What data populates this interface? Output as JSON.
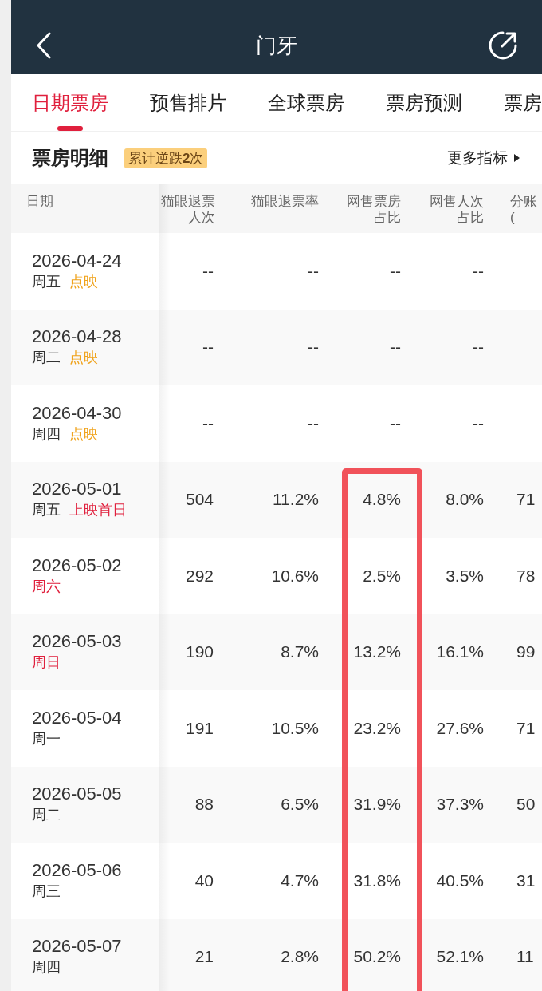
{
  "header": {
    "title": "门牙"
  },
  "tabs": [
    {
      "label": "日期票房",
      "selected": true
    },
    {
      "label": "预售排片",
      "selected": false
    },
    {
      "label": "全球票房",
      "selected": false
    },
    {
      "label": "票房预测",
      "selected": false
    },
    {
      "label": "票房",
      "selected": false
    }
  ],
  "section": {
    "title": "票房明细",
    "badge": "累计逆跌**2**次",
    "more_link": "更多指标"
  },
  "table": {
    "columns": [
      "日期",
      "猫眼退票人次",
      "猫眼退票率",
      "网售票房占比",
      "网售人次占比",
      "分账("
    ],
    "rows": [
      {
        "date": "2026-04-24",
        "weekday": "周五",
        "weekend": false,
        "tag": {
          "text": "点映",
          "kind": "preview"
        },
        "values": [
          "--",
          "--",
          "--",
          "--"
        ]
      },
      {
        "date": "2026-04-28",
        "weekday": "周二",
        "weekend": false,
        "tag": {
          "text": "点映",
          "kind": "preview"
        },
        "values": [
          "--",
          "--",
          "--",
          "--"
        ]
      },
      {
        "date": "2026-04-30",
        "weekday": "周四",
        "weekend": false,
        "tag": {
          "text": "点映",
          "kind": "preview"
        },
        "values": [
          "--",
          "--",
          "--",
          "--"
        ]
      },
      {
        "date": "2026-05-01",
        "weekday": "周五",
        "weekend": false,
        "tag": {
          "text": "上映首日",
          "kind": "premiere"
        },
        "values": [
          "504",
          "11.2%",
          "4.8%",
          "8.0%",
          "71"
        ]
      },
      {
        "date": "2026-05-02",
        "weekday": "周六",
        "weekend": true,
        "values": [
          "292",
          "10.6%",
          "2.5%",
          "3.5%",
          "78"
        ]
      },
      {
        "date": "2026-05-03",
        "weekday": "周日",
        "weekend": true,
        "values": [
          "190",
          "8.7%",
          "13.2%",
          "16.1%",
          "99"
        ]
      },
      {
        "date": "2026-05-04",
        "weekday": "周一",
        "weekend": false,
        "values": [
          "191",
          "10.5%",
          "23.2%",
          "27.6%",
          "71"
        ]
      },
      {
        "date": "2026-05-05",
        "weekday": "周二",
        "weekend": false,
        "values": [
          "88",
          "6.5%",
          "31.9%",
          "37.3%",
          "50"
        ]
      },
      {
        "date": "2026-05-06",
        "weekday": "周三",
        "weekend": false,
        "values": [
          "40",
          "4.7%",
          "31.8%",
          "40.5%",
          "31"
        ]
      },
      {
        "date": "2026-05-07",
        "weekday": "周四",
        "weekend": false,
        "values": [
          "21",
          "2.8%",
          "50.2%",
          "52.1%",
          "11"
        ]
      }
    ],
    "annotation_frame": true
  }
}
